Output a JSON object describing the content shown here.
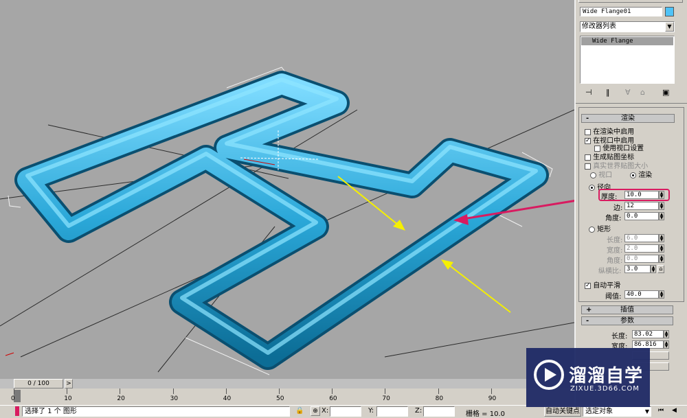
{
  "panel": {
    "object_name": "Wide Flange01",
    "object_color": "#4fc3f7",
    "modifier_list_label": "修改器列表",
    "stack_item": "Wide Flange",
    "rendering": {
      "title": "渲染",
      "enable_in_renderer": "在渲染中启用",
      "enable_in_viewport": "在视口中启用",
      "use_viewport_settings": "使用视口设置",
      "gen_mapping": "生成贴图坐标",
      "real_world_map": "真实世界贴图大小",
      "viewport_radio": "视口",
      "render_radio": "渲染",
      "radial": "径向",
      "thickness_label": "厚度:",
      "thickness_value": "10.0",
      "sides_label": "边:",
      "sides_value": "12",
      "angle_label": "角度:",
      "angle_value": "0.0",
      "rectangular": "矩形",
      "length_label": "长度:",
      "length_value": "6.0",
      "width_label": "宽度:",
      "width_value": "2.0",
      "rect_angle_label": "角度:",
      "rect_angle_value": "0.0",
      "aspect_label": "纵横比:",
      "aspect_value": "3.0",
      "auto_smooth": "自动平滑",
      "threshold_label": "阈值:",
      "threshold_value": "40.0"
    },
    "interpolation": {
      "title": "插值",
      "sign": "+"
    },
    "parameters": {
      "title": "参数",
      "sign": "-",
      "length_label": "长度:",
      "length_value": "83.02",
      "width_label": "宽度:",
      "width_value": "86.816"
    },
    "rendering_sign": "-"
  },
  "timeline": {
    "frame": "0 / 100",
    "next": ">",
    "ticks": [
      "0",
      "10",
      "20",
      "30",
      "40",
      "50",
      "60",
      "70",
      "80",
      "90"
    ]
  },
  "status": {
    "selection": "选择了 1 个 图形",
    "x_label": "X:",
    "y_label": "Y:",
    "z_label": "Z:",
    "grid": "栅格 = 10.0",
    "auto_key": "自动关键点",
    "selected_set": "选定对象"
  },
  "watermark": {
    "brand": "溜溜自学",
    "url": "ZIXUE.3D66.COM"
  },
  "colors": {
    "shape_blue": "#3aaedc",
    "highlight_pink": "#d81b60",
    "arrow_yellow": "#f5f000"
  }
}
